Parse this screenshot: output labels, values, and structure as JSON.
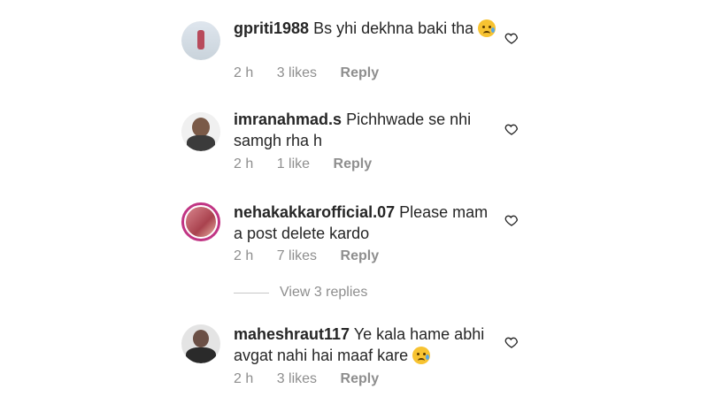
{
  "comments": [
    {
      "username": "gpriti1988",
      "text": "Bs yhi dekhna baki tha",
      "time": "2 h",
      "likes": "3 likes",
      "reply": "Reply",
      "has_emoji": true
    },
    {
      "username": "imranahmad.s",
      "text": "Pichhwade se nhi samgh rha h",
      "time": "2 h",
      "likes": "1 like",
      "reply": "Reply",
      "has_emoji": false
    },
    {
      "username": "nehakakkarofficial.07",
      "text": "Please mam a post delete kardo",
      "time": "2 h",
      "likes": "7 likes",
      "reply": "Reply",
      "has_emoji": false
    },
    {
      "username": "maheshraut117",
      "text": "Ye kala hame abhi avgat nahi hai maaf kare",
      "time": "2 h",
      "likes": "3 likes",
      "reply": "Reply",
      "has_emoji": true
    }
  ],
  "view_replies": "View 3 replies",
  "icons": {
    "like": "heart-outline-icon",
    "emoji": "sad-tear-emoji"
  },
  "colors": {
    "text": "#262626",
    "meta": "#8e8e8e",
    "story_ring": "#c13584"
  }
}
